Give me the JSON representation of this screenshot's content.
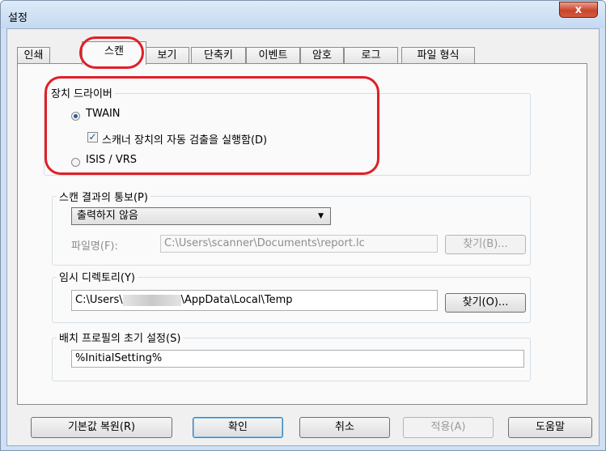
{
  "window": {
    "title": "설정",
    "close_label": "x"
  },
  "tabs": [
    {
      "label": "인쇄"
    },
    {
      "label": "스캔",
      "active": true
    },
    {
      "label": "보기"
    },
    {
      "label": "단축키"
    },
    {
      "label": "이벤트"
    },
    {
      "label": "암호"
    },
    {
      "label": "로그"
    },
    {
      "label": "파일 형식"
    }
  ],
  "device_driver": {
    "title": "장치 드라이버",
    "twain_label": "TWAIN",
    "twain_selected": true,
    "auto_detect_label": "스캐너 장치의 자동 검출을 실행함(D)",
    "auto_detect_checked": true,
    "isis_label": "ISIS / VRS",
    "isis_selected": false
  },
  "notification": {
    "title": "스캔 결과의 통보(P)",
    "selected_option": "출력하지 않음",
    "filename_label": "파일명(F):",
    "filename_value": "C:\\Users\\scanner\\Documents\\report.lc",
    "browse_label": "찾기(B)..."
  },
  "temp_dir": {
    "title": "임시 디렉토리(Y)",
    "path_prefix": "C:\\Users\\",
    "path_suffix": "\\AppData\\Local\\Temp",
    "browse_label": "찾기(O)..."
  },
  "batch_profile": {
    "title": "배치 프로필의 초기 설정(S)",
    "value": "%InitialSetting%"
  },
  "footer": {
    "restore_label": "기본값 복원(R)",
    "ok_label": "확인",
    "cancel_label": "취소",
    "apply_label": "적용(A)",
    "help_label": "도움말"
  },
  "highlight_color": "#e01f27"
}
